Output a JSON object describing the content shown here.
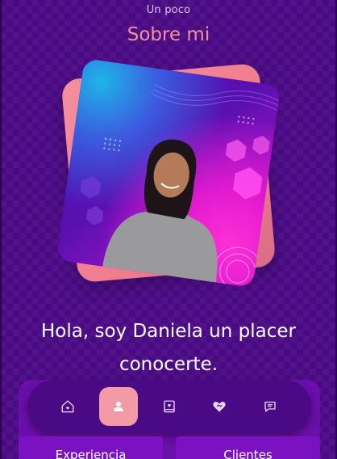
{
  "header": {
    "subtitle": "Un poco",
    "title": "Sobre mi"
  },
  "about": {
    "greeting": "Hola, soy Daniela un placer conocerte."
  },
  "nav": {
    "items": [
      {
        "icon": "home-icon",
        "active": false
      },
      {
        "icon": "user-icon",
        "active": true
      },
      {
        "icon": "portfolio-icon",
        "active": false
      },
      {
        "icon": "heart-handshake-icon",
        "active": false
      },
      {
        "icon": "chat-icon",
        "active": false
      }
    ]
  },
  "cards": {
    "left_label": "Experiencia",
    "right_label": "Clientes"
  },
  "colors": {
    "background": "#4a0a83",
    "accent": "#f29aa5",
    "title": "#f0939c",
    "panel": "#6a0faa"
  }
}
